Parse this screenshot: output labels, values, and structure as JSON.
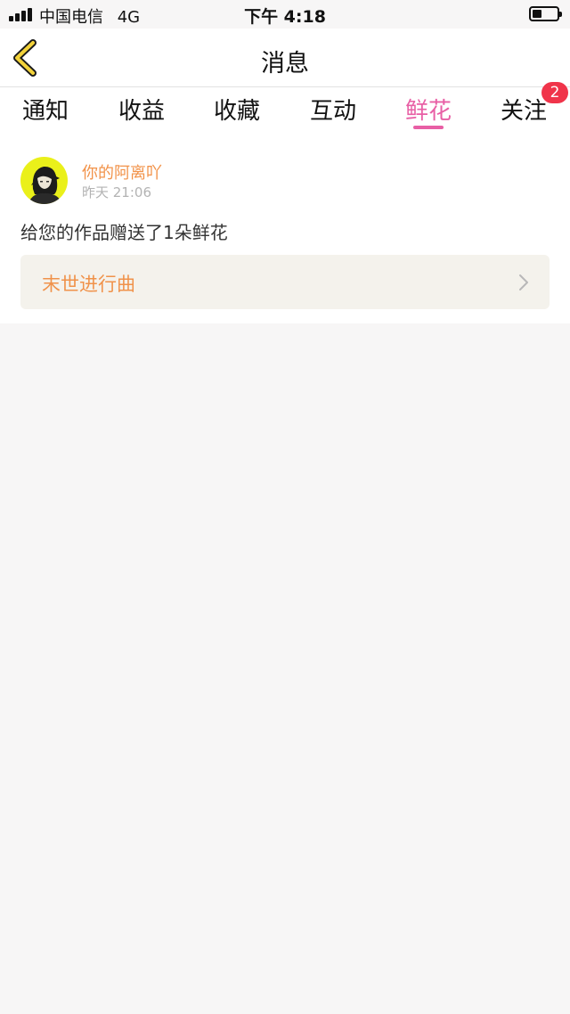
{
  "status_bar": {
    "carrier": "中国电信",
    "network": "4G",
    "time": "下午 4:18"
  },
  "nav": {
    "title": "消息",
    "back_icon": "chevron-left-icon",
    "accent": "#f2d23a"
  },
  "tabs": [
    {
      "label": "通知"
    },
    {
      "label": "收益"
    },
    {
      "label": "收藏"
    },
    {
      "label": "互动"
    },
    {
      "label": "鲜花",
      "active": true
    },
    {
      "label": "关注",
      "badge": "2"
    }
  ],
  "message": {
    "sender": "你的阿离吖",
    "time": "昨天 21:06",
    "text": "给您的作品赠送了1朵鲜花",
    "work_title": "末世进行曲"
  },
  "colors": {
    "active_tab": "#e85fa5",
    "sender": "#f2934a",
    "badge": "#f0344a",
    "background": "#f7f6f6"
  }
}
